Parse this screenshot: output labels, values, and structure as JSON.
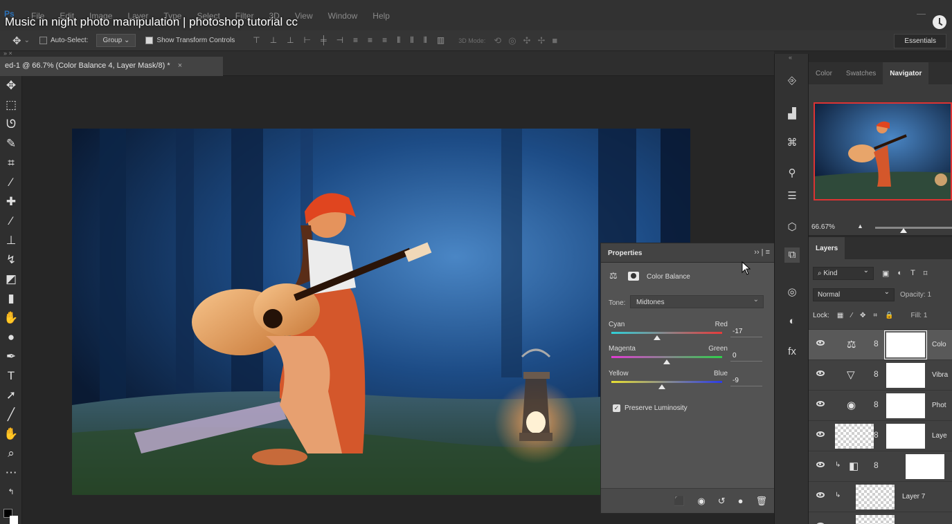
{
  "menubar": {
    "items": [
      "File",
      "Edit",
      "Image",
      "Layer",
      "Type",
      "Select",
      "Filter",
      "3D",
      "View",
      "Window",
      "Help"
    ],
    "video_title": "Music in night photo manipulation | photoshop tutorial cc",
    "app_logo": "Ps"
  },
  "options": {
    "auto_select_label": "Auto-Select:",
    "auto_select_value": "Group",
    "show_transform_label": "Show Transform Controls",
    "mode3d_label": "3D Mode:",
    "workspace": "Essentials"
  },
  "document": {
    "tab_label": "ed-1 @ 66.7% (Color Balance 4, Layer Mask/8) *",
    "close": "×"
  },
  "properties": {
    "title": "Properties",
    "adjustment": "Color Balance",
    "tone_label": "Tone:",
    "tone_value": "Midtones",
    "sliders": [
      {
        "left": "Cyan",
        "right": "Red",
        "value": "-17",
        "position": 0.415
      },
      {
        "left": "Magenta",
        "right": "Green",
        "value": "0",
        "position": 0.5
      },
      {
        "left": "Yellow",
        "right": "Blue",
        "value": "-9",
        "position": 0.455
      }
    ],
    "preserve_luminosity": "Preserve Luminosity"
  },
  "navigator": {
    "tabs": [
      "Color",
      "Swatches",
      "Navigator"
    ],
    "zoom": "66.67%"
  },
  "layers": {
    "tab": "Layers",
    "kind": "Kind",
    "blend_mode": "Normal",
    "opacity_label": "Opacity:",
    "opacity_value": "1",
    "lock_label": "Lock:",
    "fill_label": "Fill:",
    "fill_value": "1",
    "rows": [
      {
        "name": "Colo",
        "selected": true
      },
      {
        "name": "Vibra",
        "selected": false
      },
      {
        "name": "Phot",
        "selected": false
      },
      {
        "name": "Laye",
        "selected": false
      },
      {
        "name": "",
        "selected": false
      },
      {
        "name": "Layer 7",
        "selected": false
      }
    ]
  },
  "colors": {
    "accent_red": "#d33333",
    "panel_bg": "#535353",
    "canvas_bg": "#262626"
  }
}
